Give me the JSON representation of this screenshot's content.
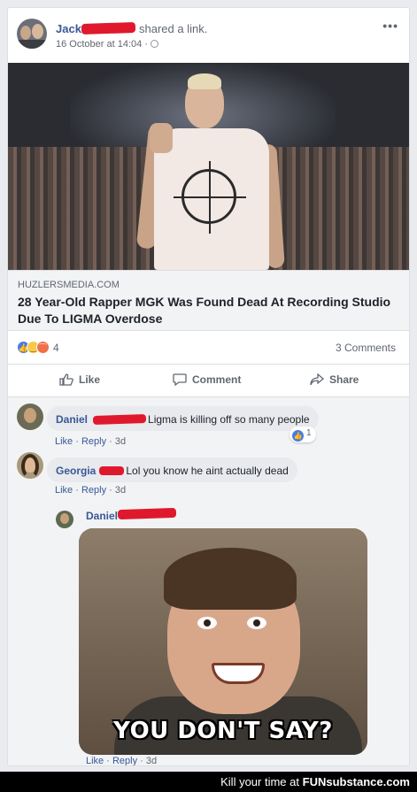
{
  "post": {
    "author": "Jack",
    "action": "shared a link.",
    "timestamp": "16 October at 14:04 ·",
    "more": "•••"
  },
  "link": {
    "domain": "HUZLERSMEDIA.COM",
    "title": "28 Year-Old Rapper MGK Was Found Dead At Recording Studio Due To LIGMA Overdose"
  },
  "reactions": {
    "count": "4",
    "comments": "3 Comments",
    "types": [
      "like",
      "haha",
      "angry"
    ]
  },
  "actions": {
    "like": "Like",
    "comment": "Comment",
    "share": "Share"
  },
  "comments": [
    {
      "name": "Daniel",
      "text": "Ligma is killing off so many people",
      "like": "Like",
      "reply": "Reply",
      "age": "3d",
      "likes": "1"
    },
    {
      "name": "Georgia",
      "text": "Lol you know he aint actually dead",
      "like": "Like",
      "reply": "Reply",
      "age": "3d"
    }
  ],
  "reply": {
    "name": "Daniel",
    "gif_caption": "YOU DON'T SAY?",
    "like": "Like",
    "reply": "Reply",
    "age": "3d"
  },
  "separator": "·",
  "footer": {
    "text": "Kill your time at",
    "brand": "FUNsubstance.com"
  },
  "colors": {
    "link_blue": "#385898",
    "redaction": "#e0182d",
    "background": "#e9ebee"
  }
}
